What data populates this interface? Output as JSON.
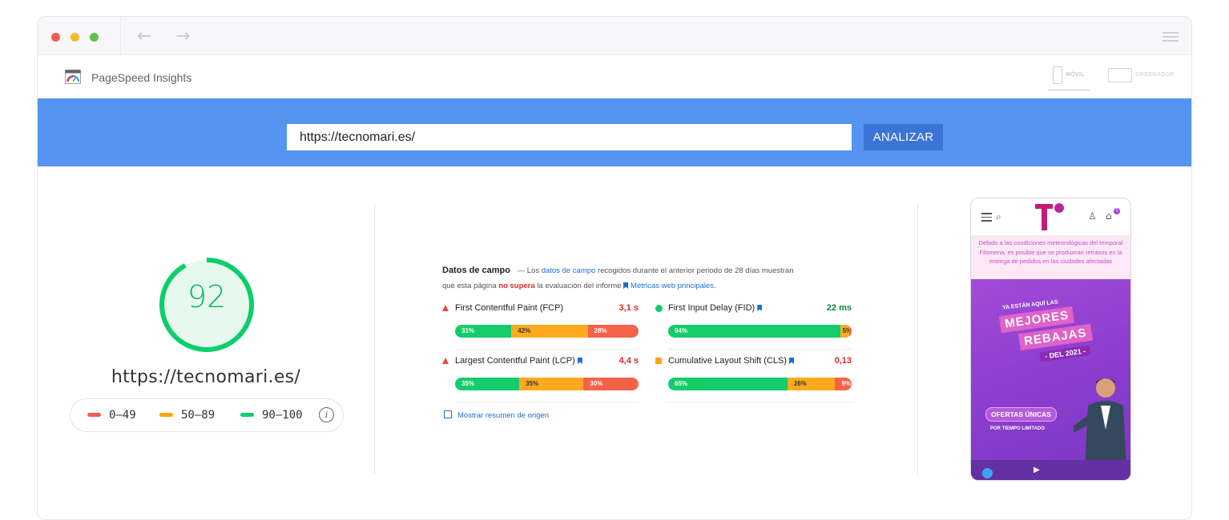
{
  "app": {
    "title": "PageSpeed Insights",
    "device_tabs": [
      {
        "label": "MÓVIL",
        "active": true
      },
      {
        "label": "ORDENADOR",
        "active": false
      }
    ]
  },
  "urlbar": {
    "url_value": "https://tecnomari.es/",
    "analyze_label": "ANALIZAR"
  },
  "score": {
    "value": 92,
    "value_text": "92",
    "fraction": 0.92,
    "color": "#0cce6b",
    "url": "https://tecnomari.es/"
  },
  "legend": [
    {
      "label": "0–49",
      "color": "#f0604d"
    },
    {
      "label": "50–89",
      "color": "#ffa400"
    },
    {
      "label": "90–100",
      "color": "#0cce6b"
    }
  ],
  "field_data": {
    "title": "Datos de campo",
    "dash": "— Los",
    "link1": "datos de campo",
    "text1": "recogidos durante el anterior periodo de 28 días muestran",
    "text2": "que esta página",
    "fail": "no supera",
    "text3": "la evaluación del informe",
    "link2": "Métricas web principales",
    "period": ".",
    "show_origin": "Mostrar resumen de origen"
  },
  "metrics": [
    {
      "name": "First Contentful Paint (FCP)",
      "value": "3,1 s",
      "status": "average",
      "value_color": "#e2262a",
      "dist": [
        {
          "pct": 31,
          "label": "31%"
        },
        {
          "pct": 42,
          "label": "42%"
        },
        {
          "pct": 28,
          "label": "28%"
        }
      ]
    },
    {
      "name": "First Input Delay (FID)",
      "value": "22 ms",
      "status": "good",
      "value_color": "#0a8a44",
      "dist": [
        {
          "pct": 94,
          "label": "94%"
        },
        {
          "pct": 5,
          "label": "5%"
        },
        {
          "pct": 1,
          "label": "1%"
        }
      ]
    },
    {
      "name": "Largest Contentful Paint (LCP)",
      "value": "4,4 s",
      "status": "average",
      "value_color": "#e2262a",
      "dist": [
        {
          "pct": 35,
          "label": "35%"
        },
        {
          "pct": 35,
          "label": "35%"
        },
        {
          "pct": 30,
          "label": "30%"
        }
      ]
    },
    {
      "name": "Cumulative Layout Shift (CLS)",
      "value": "0,13",
      "status": "needs-improvement",
      "value_color": "#e2262a",
      "dist": [
        {
          "pct": 65,
          "label": "65%"
        },
        {
          "pct": 26,
          "label": "26%"
        },
        {
          "pct": 9,
          "label": "9%"
        }
      ]
    }
  ],
  "phone_preview": {
    "notice": "Debido a las condiciones meteorológicas del temporal Filomena, es posible que se produzcan retrasos en la entrega de pedidos en las ciudades afectadas",
    "cart_count": "0",
    "banner_sub": "YA ESTÁN AQUÍ LAS",
    "banner_big1": "MEJORES",
    "banner_big2": "REBAJAS",
    "banner_del": "- DEL 2021 -",
    "offer": "OFERTAS ÚNICAS",
    "limited": "POR TIEMPO LIMITADO"
  }
}
